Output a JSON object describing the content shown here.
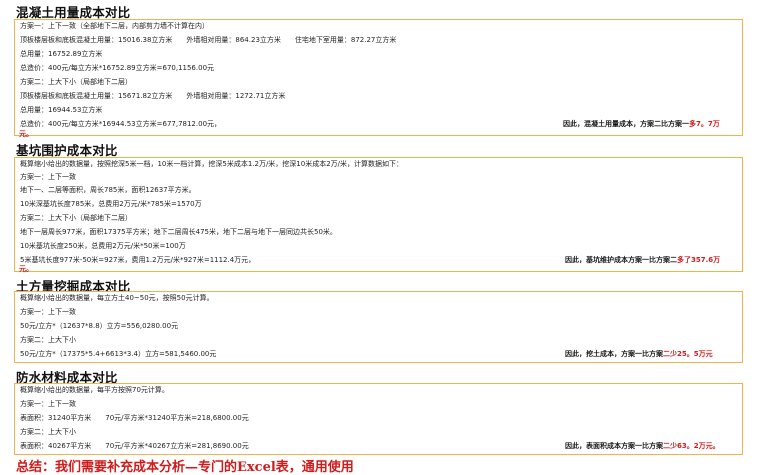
{
  "concrete": {
    "title": "混凝土用量成本对比",
    "lines": [
      "方案一：上下一致（全部地下二层，内部剪力墙不计算在内）",
      "顶板楼层板和底板混凝土用量：15016.38立方米　　外墙相对用量：864.23立方米　　住宅地下室用量：872.27立方米",
      "总用量：16752.89立方米",
      "总造价：400元/每立方米*16752.89立方米=670,1156.00元",
      "方案二：上大下小（局部地下二层）",
      "顶板楼层板和底板混凝土用量：15671.82立方米　　外墙相对用量：1272.71立方米",
      "总用量：16944.53立方米",
      "总造价：400元/每立方米*16944.53立方米=677,7812.00元，"
    ],
    "conclusion_prefix": "因此，混凝土用量成本，方案二比方案一",
    "conclusion_highlight": "多7。7万",
    "conclusion_wrap": "元。"
  },
  "excavation_support": {
    "title": "基坑围护成本对比",
    "lines": [
      "概算缩小给出的数据量，按照挖深5米一档，10米一档计算，挖深5米成本1.2万/米，挖深10米成本2万/米，计算数据如下：",
      "方案一：上下一致",
      "地下一、二层等面积，周长785米，面积12637平方米。",
      "10米深基坑长度785米，总费用2万元/米*785米=1570万",
      "方案二：上大下小（局部地下二层）",
      "地下一层周长977米，面积17375平方米；地下二层周长475米，地下二层与地下一层同边共长50米。",
      "10米基坑长度250米，总费用2万元/米*50米=100万",
      "5米基坑长度977米-50米=927米，费用1.2万元/米*927米=1112.4万元，"
    ],
    "conclusion_prefix": "因此，基坑维护成本方案一比方案二",
    "conclusion_highlight": "多了357.6万",
    "conclusion_wrap": "元。"
  },
  "earthwork": {
    "title": "土方量挖掘成本对比",
    "lines": [
      "概算缩小给出的数据量，每立方土40~50元，按照50元计算。",
      "方案一：上下一致",
      "50元/立方*（12637*8.8）立方=556,0280.00元",
      "方案二：上大下小",
      "50元/立方*（17375*5.4+6613*3.4）立方=581,5460.00元"
    ],
    "conclusion_prefix": "因此，挖土成本，方案一比方案",
    "conclusion_highlight": "二少25。5万元"
  },
  "waterproof": {
    "title": "防水材料成本对比",
    "lines": [
      "概算缩小给出的数据量，每平方按照70元计算。",
      "方案一：上下一致",
      "表面积：31240平方米　　70元/平方米*31240平方米=218,6800.00元",
      "方案二：上大下小",
      "表面积：40267平方米　　70元/平方米*40267立方米=281,8690.00元"
    ],
    "conclusion_prefix": "因此，表面积成本方案一比方案",
    "conclusion_highlight": "二少63。2万元。"
  },
  "summary": "总结：我们需要补充成本分析—专门的Excel表，通用使用",
  "colors": {
    "border": "#f0b54a",
    "highlight": "#d11b1b",
    "text": "#1f1f1f"
  }
}
